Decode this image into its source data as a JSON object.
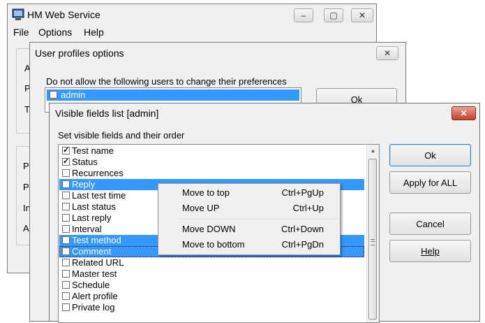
{
  "main_window": {
    "title": "HM Web Service",
    "menu": [
      "File",
      "Options",
      "Help"
    ],
    "controls": {
      "minimize": "–",
      "maximize": "▢",
      "close": "✕"
    },
    "left_letters_top": [
      "A",
      "P",
      "T"
    ],
    "left_letters_bottom": [
      "P",
      "P",
      "In",
      "A"
    ]
  },
  "profiles_dialog": {
    "title": "User profiles options",
    "close": "✕",
    "label": "Do not allow the following users to change their preferences",
    "users": [
      {
        "name": "admin",
        "checked": false,
        "selected": true
      }
    ],
    "ok_label": "Ok"
  },
  "fields_dialog": {
    "title": "Visible fields list [admin]",
    "close": "✕",
    "label": "Set visible fields and their order",
    "fields": [
      {
        "name": "Test name",
        "checked": true,
        "selected": false
      },
      {
        "name": "Status",
        "checked": true,
        "selected": false
      },
      {
        "name": "Recurrences",
        "checked": false,
        "selected": false
      },
      {
        "name": "Reply",
        "checked": true,
        "selected": true
      },
      {
        "name": "Last test time",
        "checked": false,
        "selected": false
      },
      {
        "name": "Last status",
        "checked": false,
        "selected": false
      },
      {
        "name": "Last reply",
        "checked": false,
        "selected": false
      },
      {
        "name": "Interval",
        "checked": false,
        "selected": false
      },
      {
        "name": "Test method",
        "checked": true,
        "selected": true
      },
      {
        "name": "Comment",
        "checked": true,
        "selected": true
      },
      {
        "name": "Related URL",
        "checked": false,
        "selected": false
      },
      {
        "name": "Master test",
        "checked": false,
        "selected": false
      },
      {
        "name": "Schedule",
        "checked": false,
        "selected": false
      },
      {
        "name": "Alert profile",
        "checked": false,
        "selected": false
      },
      {
        "name": "Private log",
        "checked": false,
        "selected": false
      }
    ],
    "buttons": {
      "ok": "Ok",
      "apply_all": "Apply for ALL",
      "cancel": "Cancel",
      "help": "Help"
    }
  },
  "context_menu": {
    "items": [
      {
        "label": "Move to top",
        "shortcut": "Ctrl+PgUp"
      },
      {
        "label": "Move UP",
        "shortcut": "Ctrl+Up"
      },
      {
        "label": "Move DOWN",
        "shortcut": "Ctrl+Down"
      },
      {
        "label": "Move to bottom",
        "shortcut": "Ctrl+PgDn"
      }
    ]
  },
  "colors": {
    "selection": "#3399ff",
    "dialog_bg": "#f0f0f0",
    "close_button": "#c4412b"
  }
}
